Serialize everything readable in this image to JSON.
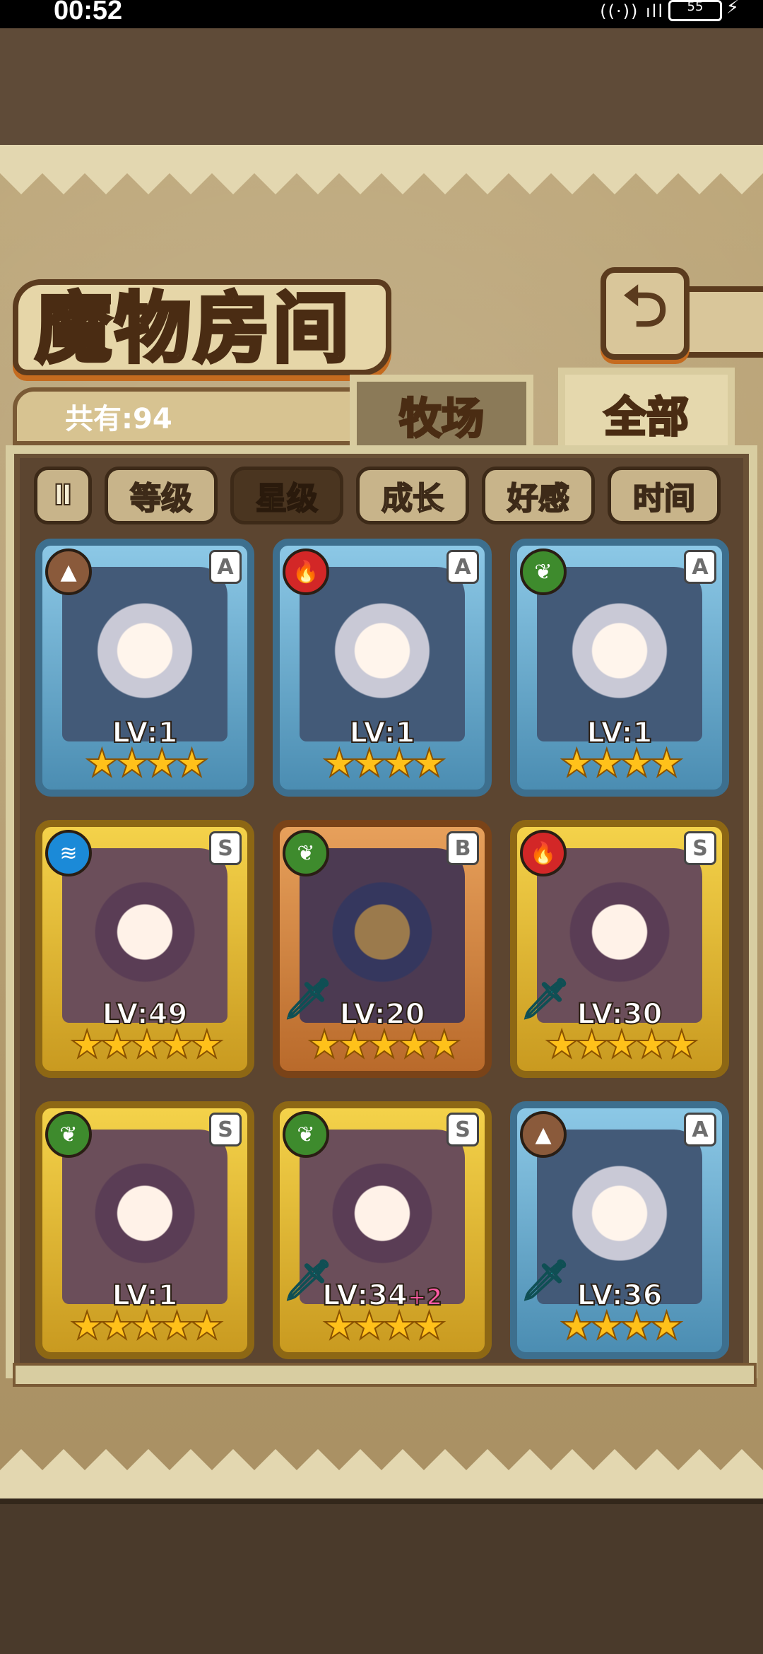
{
  "status": {
    "time": "00:52",
    "battery": "55",
    "signal": "((·)) ıll"
  },
  "title": "魔物房间",
  "back_icon": "back-arrow-icon",
  "count": "共有:94",
  "tabs": {
    "farm": "牧场",
    "all": "全部"
  },
  "sort": {
    "toggle_icon": "Ⅱ",
    "buttons": [
      "等级",
      "星级",
      "成长",
      "好感",
      "时间"
    ],
    "active": "星级"
  },
  "monsters": [
    {
      "element": "earth",
      "rank": "A",
      "frame": "blue",
      "level": "LV:1",
      "bonus": "",
      "stars": 4,
      "weapon": false
    },
    {
      "element": "fire",
      "rank": "A",
      "frame": "blue",
      "level": "LV:1",
      "bonus": "",
      "stars": 4,
      "weapon": false
    },
    {
      "element": "grass",
      "rank": "A",
      "frame": "blue",
      "level": "LV:1",
      "bonus": "",
      "stars": 4,
      "weapon": false
    },
    {
      "element": "water",
      "rank": "S",
      "frame": "gold",
      "level": "LV:49",
      "bonus": "",
      "stars": 5,
      "weapon": false
    },
    {
      "element": "grass",
      "rank": "B",
      "frame": "bronze",
      "level": "LV:20",
      "bonus": "",
      "stars": 5,
      "weapon": true
    },
    {
      "element": "fire",
      "rank": "S",
      "frame": "gold",
      "level": "LV:30",
      "bonus": "",
      "stars": 5,
      "weapon": true
    },
    {
      "element": "grass",
      "rank": "S",
      "frame": "gold",
      "level": "LV:1",
      "bonus": "",
      "stars": 5,
      "weapon": false
    },
    {
      "element": "grass",
      "rank": "S",
      "frame": "gold",
      "level": "LV:34",
      "bonus": "+2",
      "stars": 4,
      "weapon": true
    },
    {
      "element": "earth",
      "rank": "A",
      "frame": "blue",
      "level": "LV:36",
      "bonus": "",
      "stars": 4,
      "weapon": true
    }
  ]
}
